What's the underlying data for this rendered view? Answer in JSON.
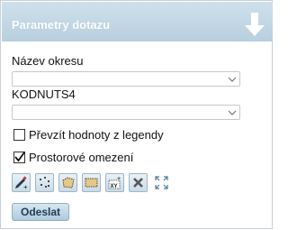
{
  "panel": {
    "title": "Parametry dotazu",
    "collapse_icon": "down-arrow-icon"
  },
  "fields": {
    "district_label": "Název okresu",
    "district_value": "",
    "kodnuts_label": "KODNUTS4",
    "kodnuts_value": ""
  },
  "options": {
    "legend_label": "Převzít hodnoty z legendy",
    "legend_checked": false,
    "spatial_label": "Prostorové omezení",
    "spatial_checked": true
  },
  "toolbar": {
    "icons": [
      "draw-pencil-icon",
      "points-icon",
      "polygon-icon",
      "rectangle-icon",
      "xy-coordinates-icon",
      "delete-icon",
      "extent-icon"
    ]
  },
  "actions": {
    "submit_label": "Odeslat"
  },
  "colors": {
    "header_bg": "#c4d8e6",
    "button_bg": "#c9dbe7",
    "accent": "#4a7897"
  }
}
